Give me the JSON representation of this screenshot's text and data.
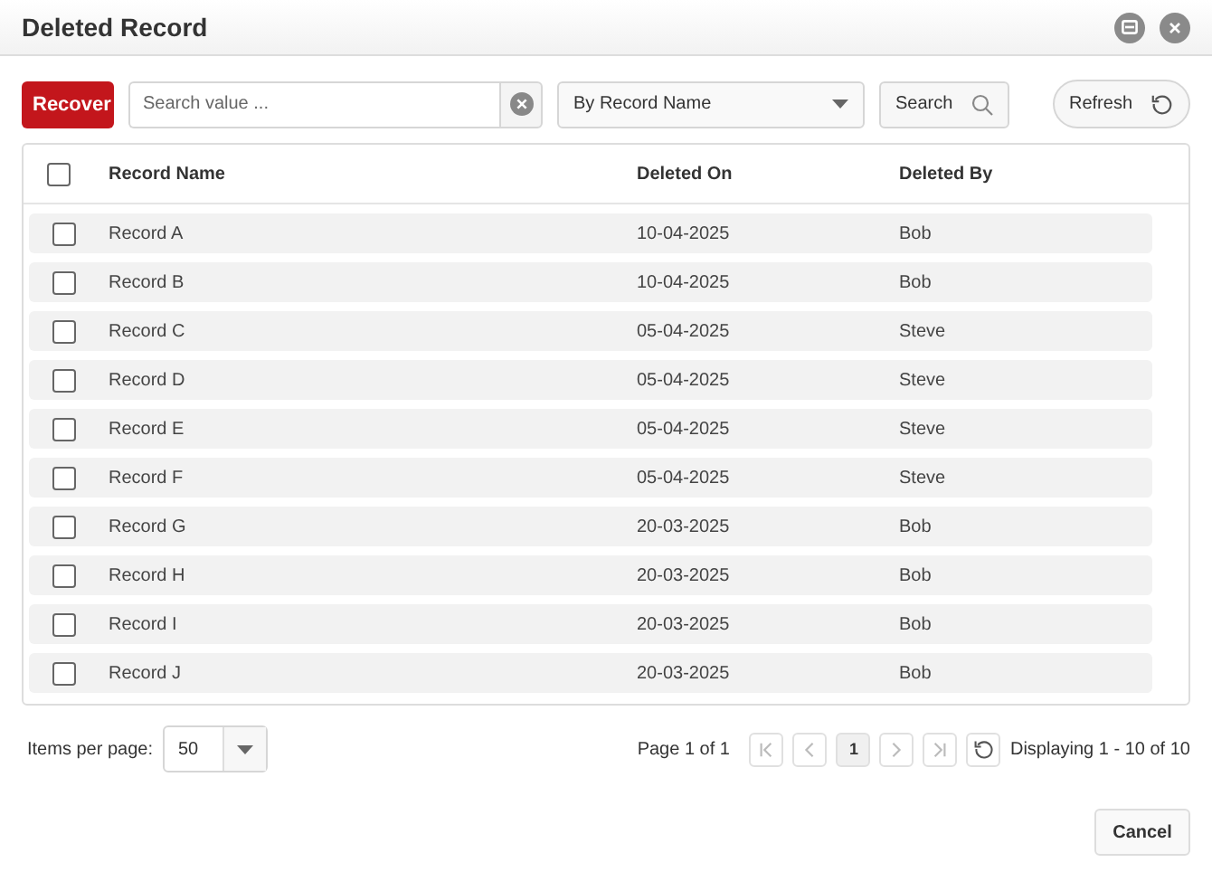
{
  "window": {
    "title": "Deleted Record"
  },
  "toolbar": {
    "recover": "Recover",
    "search": {
      "placeholder": "Search value ..."
    },
    "filter": "By Record Name",
    "search_button": "Search",
    "refresh": "Refresh"
  },
  "table": {
    "select_all": {
      "checked": false
    },
    "columns": [
      "Record Name",
      "Deleted On",
      "Deleted By"
    ],
    "rows": [
      {
        "checked": false,
        "cells": [
          "Record A",
          "10-04-2025",
          "Bob"
        ]
      },
      {
        "checked": false,
        "cells": [
          "Record B",
          "10-04-2025",
          "Bob"
        ]
      },
      {
        "checked": false,
        "cells": [
          "Record C",
          "05-04-2025",
          "Steve"
        ]
      },
      {
        "checked": false,
        "cells": [
          "Record D",
          "05-04-2025",
          "Steve"
        ]
      },
      {
        "checked": false,
        "cells": [
          "Record E",
          "05-04-2025",
          "Steve"
        ]
      },
      {
        "checked": false,
        "cells": [
          "Record F",
          "05-04-2025",
          "Steve"
        ]
      },
      {
        "checked": false,
        "cells": [
          "Record G",
          "20-03-2025",
          "Bob"
        ]
      },
      {
        "checked": false,
        "cells": [
          "Record H",
          "20-03-2025",
          "Bob"
        ]
      },
      {
        "checked": false,
        "cells": [
          "Record I",
          "20-03-2025",
          "Bob"
        ]
      },
      {
        "checked": false,
        "cells": [
          "Record J",
          "20-03-2025",
          "Bob"
        ]
      }
    ]
  },
  "pager": {
    "items_label": "Items per page:",
    "per_page": "50",
    "page_info": "Page 1 of 1",
    "pages": [
      {
        "label": "1",
        "selected": true
      }
    ],
    "display": "Displaying 1 - 10 of 10"
  },
  "buttons": [
    "Cancel"
  ]
}
